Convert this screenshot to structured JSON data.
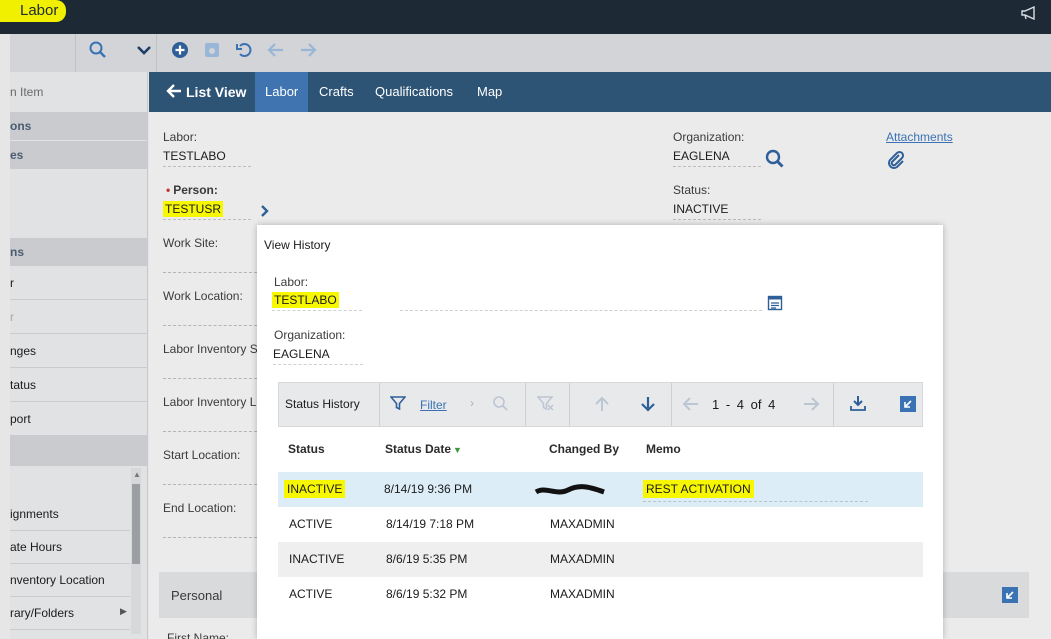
{
  "app": {
    "title": "Labor"
  },
  "toolbar": {
    "search_icon": "search-icon",
    "chevron_icon": "chevron-down-icon"
  },
  "sidebar": {
    "items": [
      {
        "label": "n Item",
        "kind": "search"
      },
      {
        "label": "ons",
        "kind": "header"
      },
      {
        "label": "es",
        "kind": "header"
      },
      {
        "label": "ns",
        "kind": "header"
      },
      {
        "label": "r",
        "kind": "item"
      },
      {
        "label": "r",
        "kind": "item-disabled"
      },
      {
        "label": "nges",
        "kind": "item"
      },
      {
        "label": "tatus",
        "kind": "item"
      },
      {
        "label": "port",
        "kind": "item"
      },
      {
        "label": "ignments",
        "kind": "item"
      },
      {
        "label": "ate Hours",
        "kind": "item"
      },
      {
        "label": "nventory Location",
        "kind": "item"
      },
      {
        "label": "rary/Folders",
        "kind": "item"
      }
    ]
  },
  "tabs": {
    "list_view": "List View",
    "labor": "Labor",
    "crafts": "Crafts",
    "qualifications": "Qualifications",
    "map": "Map"
  },
  "form": {
    "labor_label": "Labor:",
    "labor_value": "TESTLABO",
    "person_label": "Person:",
    "person_value": "TESTUSR",
    "work_site_label": "Work Site:",
    "work_location_label": "Work Location:",
    "labor_inv1_label": "Labor Inventory S",
    "labor_inv2_label": "Labor Inventory L",
    "start_location_label": "Start Location:",
    "end_location_label": "End Location:",
    "organization_label": "Organization:",
    "organization_value": "EAGLENA",
    "status_label": "Status:",
    "status_value": "INACTIVE",
    "attachments": "Attachments",
    "personal_section": "Personal",
    "first_name_label": "First Name:"
  },
  "dialog": {
    "title": "View History",
    "labor_label": "Labor:",
    "labor_value": "TESTLABO",
    "organization_label": "Organization:",
    "organization_value": "EAGLENA",
    "grid": {
      "title": "Status History",
      "filter": "Filter",
      "pagination": "1 - 4 of 4",
      "columns": [
        "Status",
        "Status Date",
        "Changed By",
        "Memo"
      ],
      "rows": [
        {
          "status": "INACTIVE",
          "date": "8/14/19 9:36 PM",
          "changed_by": "",
          "memo": "REST ACTIVATION"
        },
        {
          "status": "ACTIVE",
          "date": "8/14/19 7:18 PM",
          "changed_by": "MAXADMIN",
          "memo": ""
        },
        {
          "status": "INACTIVE",
          "date": "8/6/19 5:35 PM",
          "changed_by": "MAXADMIN",
          "memo": ""
        },
        {
          "status": "ACTIVE",
          "date": "8/6/19 5:32 PM",
          "changed_by": "MAXADMIN",
          "memo": ""
        }
      ]
    }
  },
  "colors": {
    "header_dark": "#1d2a36",
    "tab_bar": "#2d5375",
    "tab_active": "#3f74b0",
    "accent": "#3b72b3",
    "highlight": "#f7f700",
    "selected_row": "#dcedf7"
  }
}
